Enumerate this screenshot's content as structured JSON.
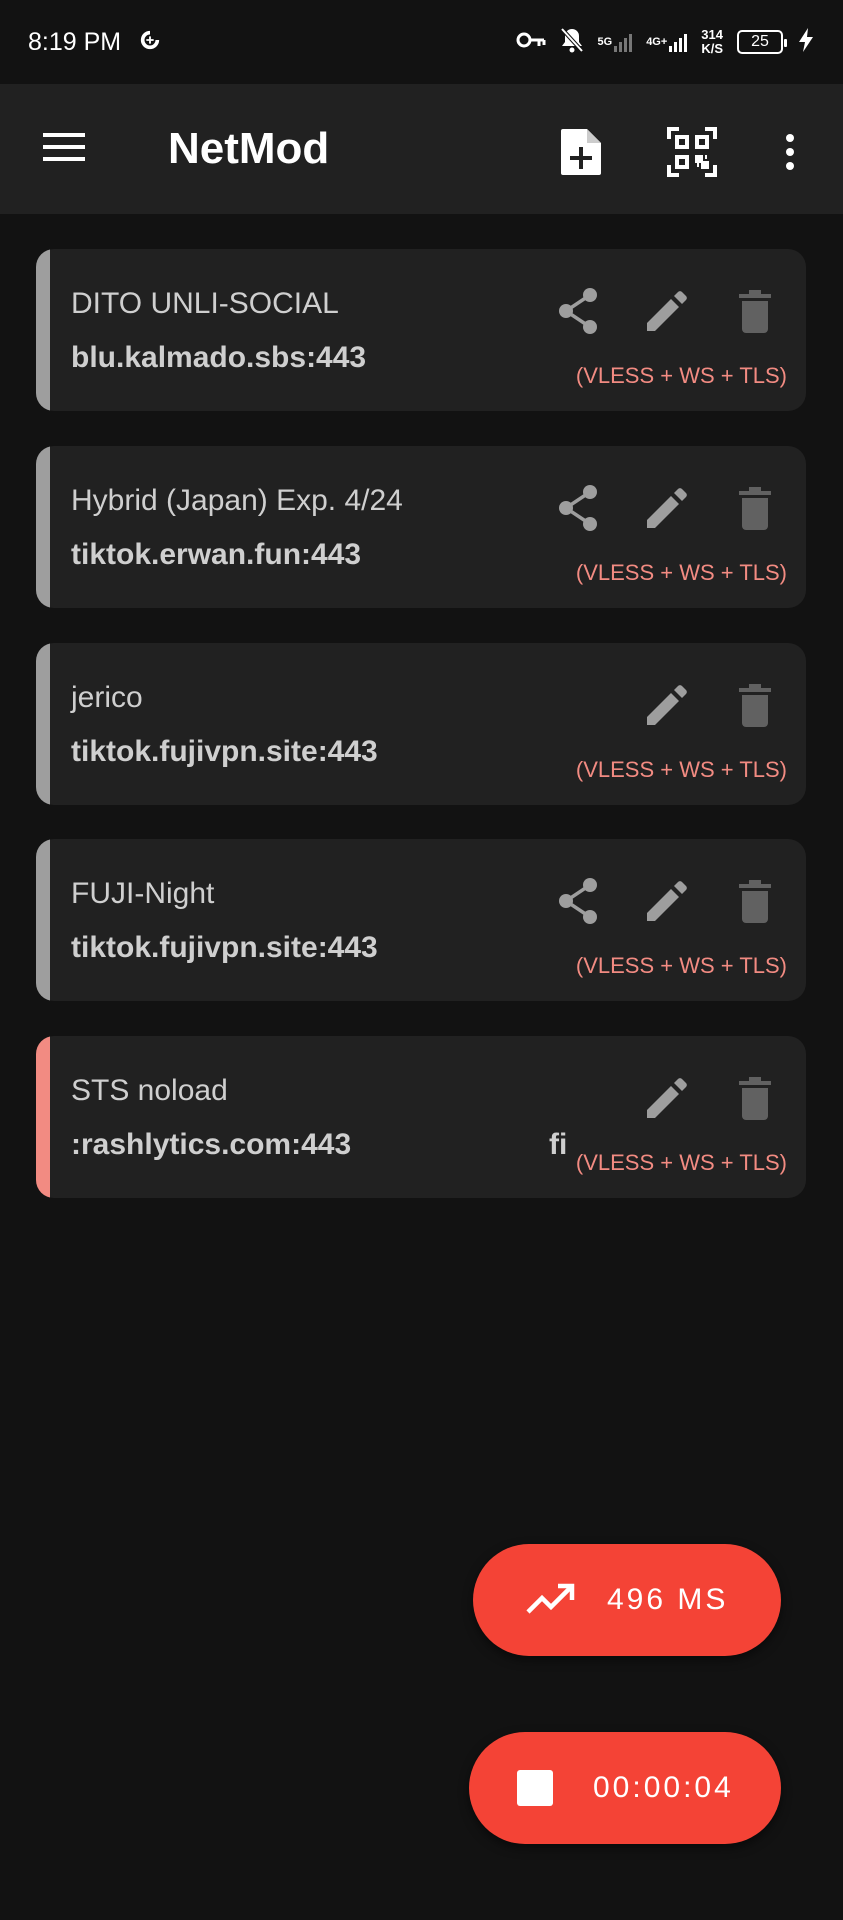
{
  "status_bar": {
    "time": "8:19 PM",
    "network_1": "5G",
    "network_2": "4G+",
    "speed_value": "314",
    "speed_unit": "K/S",
    "battery": "25",
    "icons": [
      "data-saver-icon",
      "key-icon",
      "bell-off-icon",
      "signal-icon",
      "battery-icon",
      "charging-icon"
    ]
  },
  "app_bar": {
    "title": "NetMod",
    "icons": [
      "menu-icon",
      "add-file-icon",
      "qr-code-icon",
      "more-vert-icon"
    ]
  },
  "configs": [
    {
      "name": "DITO UNLI-SOCIAL",
      "host": "blu.kalmado.sbs:443",
      "protocol": "(VLESS + WS + TLS)",
      "shareable": true,
      "active": false
    },
    {
      "name": "Hybrid (Japan) Exp. 4/24",
      "host": "tiktok.erwan.fun:443",
      "protocol": "(VLESS + WS + TLS)",
      "shareable": true,
      "active": false
    },
    {
      "name": "jerico",
      "host": "tiktok.fujivpn.site:443",
      "protocol": "(VLESS + WS + TLS)",
      "shareable": false,
      "active": false
    },
    {
      "name": "FUJI-Night",
      "host": "tiktok.fujivpn.site:443",
      "protocol": "(VLESS + WS + TLS)",
      "shareable": true,
      "active": false
    },
    {
      "name": "STS noload",
      "host": ":rashlytics.com:443",
      "host_marquee_next": "fi",
      "protocol": "(VLESS + WS + TLS)",
      "shareable": false,
      "active": true
    }
  ],
  "ping_button": {
    "label": "496 MS",
    "icon": "trending-up-icon"
  },
  "timer_button": {
    "label": "00:00:04",
    "icon": "stop-icon"
  },
  "colors": {
    "background": "#121212",
    "surface": "#212121",
    "accent": "#f44336",
    "protocol_text": "#f28b82",
    "inactive_stripe": "#9e9e9e",
    "active_stripe": "#f28b82"
  }
}
